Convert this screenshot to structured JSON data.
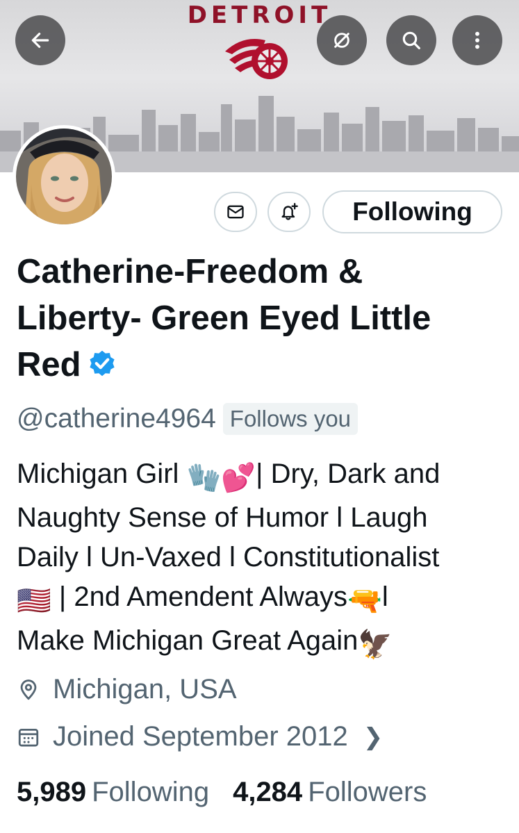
{
  "banner": {
    "title": "DETROIT",
    "brand_color": "#8f1228",
    "logo": "winged-wheel-logo"
  },
  "nav": {
    "back_icon": "arrow-left-icon",
    "translate_icon": "eye-slash-icon",
    "search_icon": "search-icon",
    "more_icon": "more-vertical-icon"
  },
  "profile": {
    "name": "Catherine-Freedom & Liberty- Green Eyed Little Red",
    "name_line1": "Catherine-Freedom &",
    "name_line2": "Liberty- Green Eyed Little",
    "name_line3": "Red",
    "verified_color": "#1d9bf0",
    "handle": "@catherine4964",
    "follows_you": "Follows you",
    "bio": {
      "line1_a": "Michigan Girl ",
      "line1_emoji": "🧤💕",
      "line1_b": "| Dry, Dark and",
      "line2": "Naughty Sense of Humor l Laugh",
      "line3": "Daily l Un-Vaxed l Constitutionalist",
      "line4_flag": "🇺🇸",
      "line4_a": " | 2nd Amendent Always",
      "line4_emoji": "🔫",
      "line4_b": "l",
      "line5_a": "Make Michigan Great Again",
      "line5_emoji": "🦅"
    },
    "location": "Michigan, USA",
    "joined": "Joined September 2012",
    "following_count": "5,989",
    "following_label": "Following",
    "followers_count": "4,284",
    "followers_label": "Followers"
  },
  "actions": {
    "message_icon": "mail-icon",
    "notify_icon": "bell-plus-icon",
    "following_button": "Following"
  }
}
